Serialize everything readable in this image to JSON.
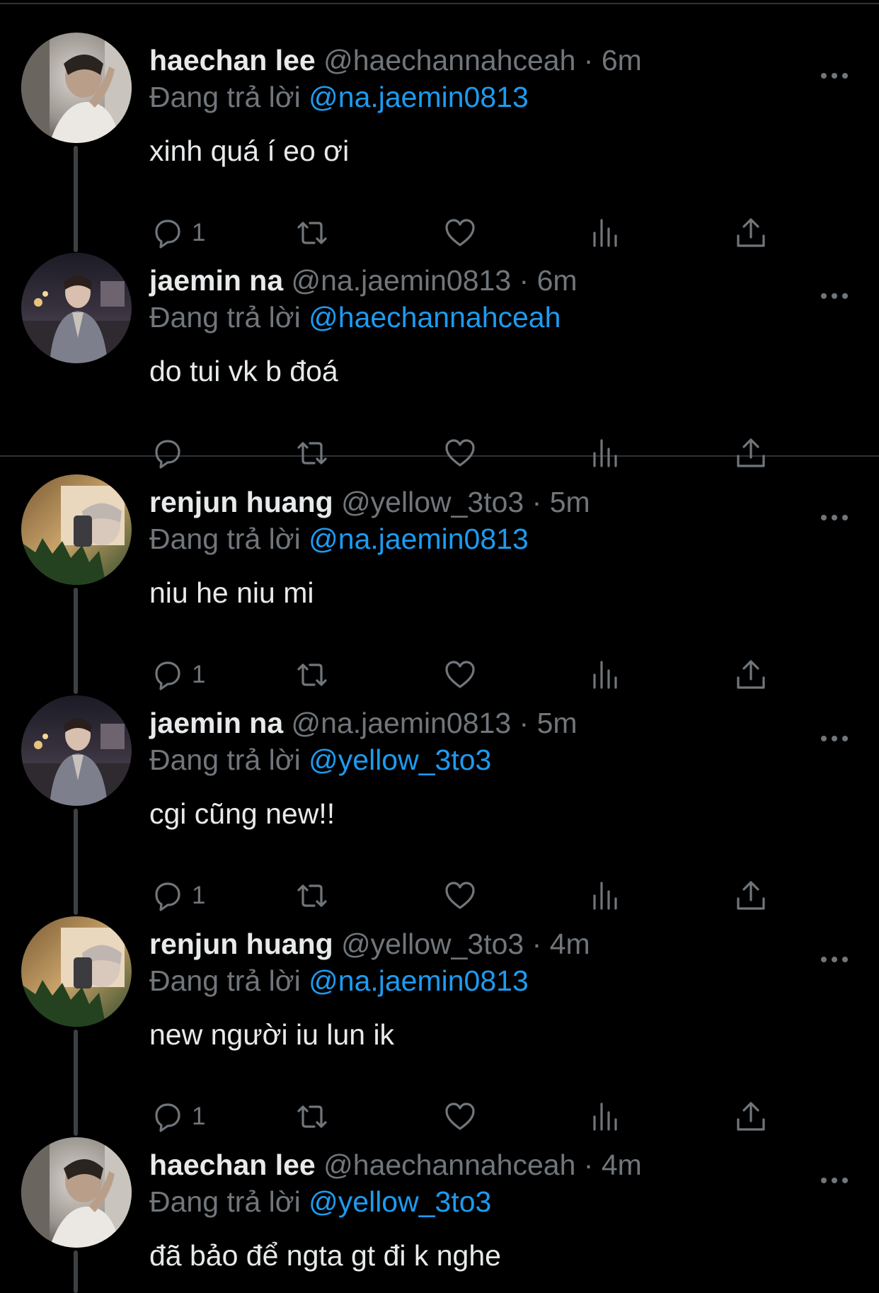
{
  "reply_prefix": "Đang trả lời",
  "colors": {
    "background": "#000000",
    "text_primary": "#e7e9ea",
    "text_secondary": "#71767b",
    "mention": "#1d9bf0",
    "divider": "#2f3336"
  },
  "icons": {
    "reply": "reply-bubble-icon",
    "retweet": "retweet-icon",
    "like": "heart-icon",
    "views": "views-bar-chart-icon",
    "share": "share-upload-icon",
    "more": "more-options-icon"
  },
  "tweets": [
    {
      "name": "haechan lee",
      "handle": "@haechannahceah",
      "separator": "·",
      "time": "6m",
      "reply_to": "@na.jaemin0813",
      "text": "xinh quá í eo ơi",
      "reply_count": "1"
    },
    {
      "name": "jaemin na",
      "handle": "@na.jaemin0813",
      "separator": "·",
      "time": "6m",
      "reply_to": "@haechannahceah",
      "text": "do tui vk b đoá",
      "reply_count": ""
    },
    {
      "name": "renjun huang",
      "handle": "@yellow_3to3",
      "separator": "·",
      "time": "5m",
      "reply_to": "@na.jaemin0813",
      "text": "niu he niu mi",
      "reply_count": "1"
    },
    {
      "name": "jaemin na",
      "handle": "@na.jaemin0813",
      "separator": "·",
      "time": "5m",
      "reply_to": "@yellow_3to3",
      "text": "cgi cũng new!!",
      "reply_count": "1"
    },
    {
      "name": "renjun huang",
      "handle": "@yellow_3to3",
      "separator": "·",
      "time": "4m",
      "reply_to": "@na.jaemin0813",
      "text": "new người iu lun ik",
      "reply_count": "1"
    },
    {
      "name": "haechan lee",
      "handle": "@haechannahceah",
      "separator": "·",
      "time": "4m",
      "reply_to": "@yellow_3to3",
      "text": "đã bảo để ngta gt đi k nghe",
      "reply_count": ""
    }
  ]
}
